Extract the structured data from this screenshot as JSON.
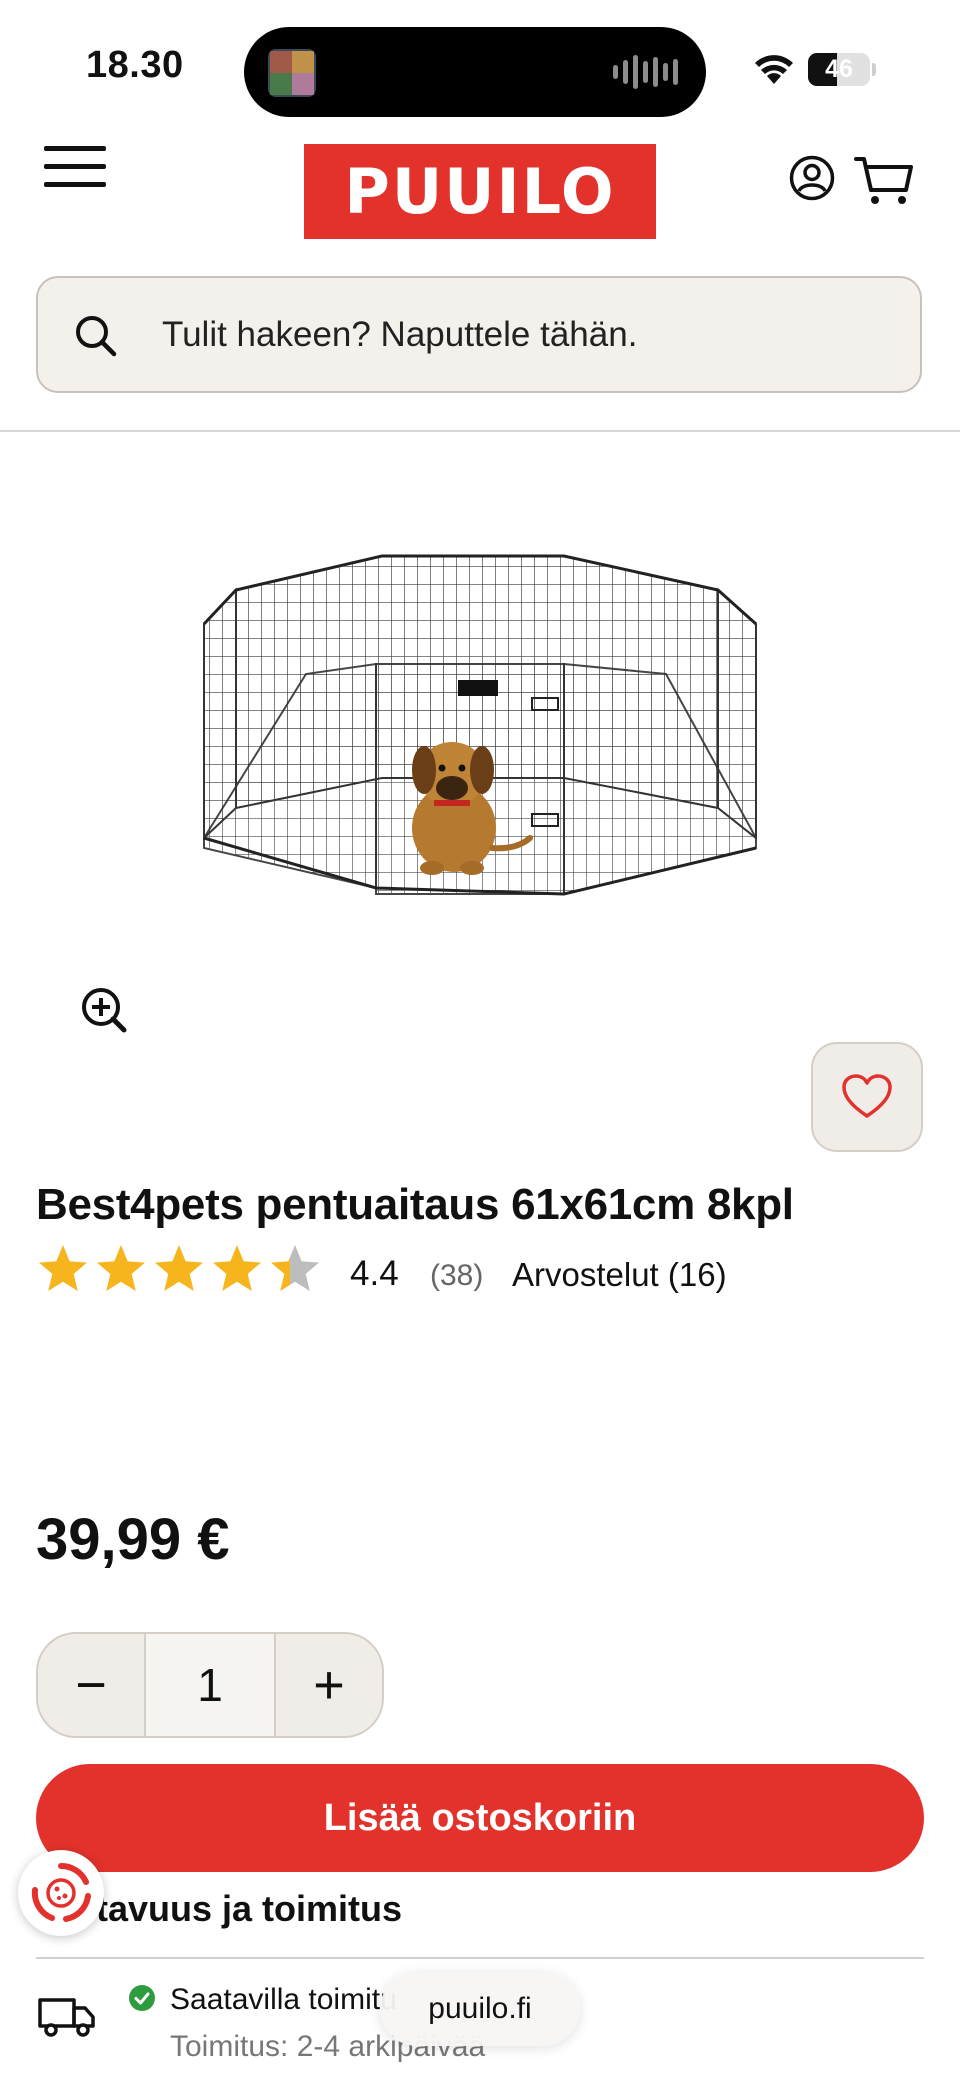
{
  "status_bar": {
    "time": "18.30",
    "battery_level": "46",
    "battery_fraction": 0.46
  },
  "header": {
    "logo_text": "PUUILO"
  },
  "search": {
    "placeholder": "Tulit hakeen? Naputtele tähän."
  },
  "product": {
    "title": "Best4pets pentuaitaus 61x61cm 8kpl",
    "rating_value": "4.4",
    "rating_stars": 4.4,
    "rating_max": 5,
    "rating_count": "(38)",
    "reviews_link": "Arvostelut (16)",
    "price": "39,99 €",
    "quantity": "1",
    "quantity_minus": "−",
    "quantity_plus": "+",
    "add_to_cart_label": "Lisää ostoskoriin"
  },
  "availability": {
    "heading": "tavuus ja toimitus",
    "status": "Saatavilla toimitu",
    "delivery_time": "Toimitus: 2-4 arkipäivää"
  },
  "browser": {
    "url": "puuilo.fi"
  },
  "colors": {
    "brand_red": "#e2322b",
    "star_gold": "#f6b51d",
    "star_grey": "#bdbdbd",
    "check_green": "#2e9b3e"
  },
  "icons": [
    "menu-icon",
    "account-icon",
    "cart-icon",
    "search-icon",
    "zoom-in-icon",
    "heart-icon",
    "star-icon",
    "cookie-icon",
    "truck-icon",
    "check-icon"
  ]
}
